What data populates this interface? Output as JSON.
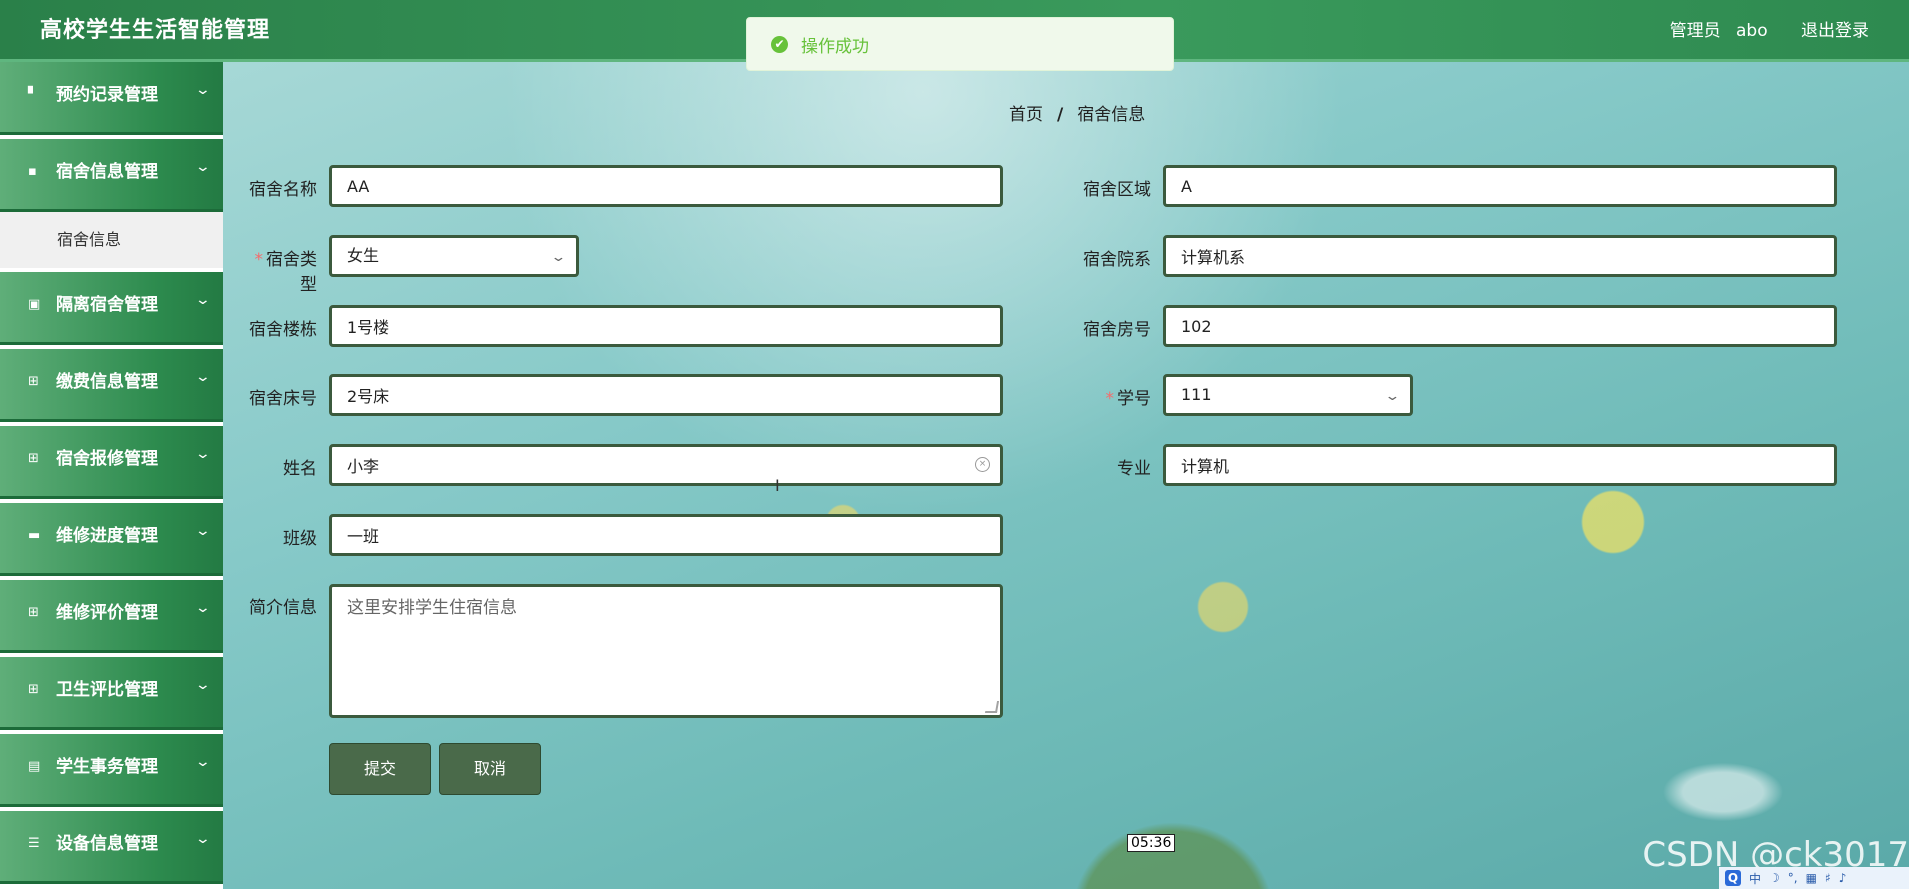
{
  "app": {
    "title": "高校学生生活智能管理"
  },
  "header": {
    "user_role": "管理员",
    "username": "abo",
    "logout_label": "退出登录"
  },
  "toast": {
    "message": "操作成功",
    "icon": "success-check-icon",
    "color": "#67c23a"
  },
  "sidebar": {
    "items": [
      {
        "label": "预约记录管理",
        "icon": "bookmark-icon",
        "glyph": "▘"
      },
      {
        "label": "宿舍信息管理",
        "icon": "chat-icon",
        "glyph": "▪",
        "expanded": true,
        "children": [
          {
            "label": "宿舍信息",
            "active": true
          }
        ]
      },
      {
        "label": "隔离宿舍管理",
        "icon": "checkbox-icon",
        "glyph": "▣"
      },
      {
        "label": "缴费信息管理",
        "icon": "grid-icon",
        "glyph": "⊞"
      },
      {
        "label": "宿舍报修管理",
        "icon": "grid-icon",
        "glyph": "⊞"
      },
      {
        "label": "维修进度管理",
        "icon": "briefcase-icon",
        "glyph": "▬"
      },
      {
        "label": "维修评价管理",
        "icon": "grid-icon",
        "glyph": "⊞"
      },
      {
        "label": "卫生评比管理",
        "icon": "grid-icon",
        "glyph": "⊞"
      },
      {
        "label": "学生事务管理",
        "icon": "clipboard-icon",
        "glyph": "▤"
      },
      {
        "label": "设备信息管理",
        "icon": "list-icon",
        "glyph": "☰"
      }
    ]
  },
  "breadcrumb": {
    "home": "首页",
    "separator": "/",
    "current": "宿舍信息"
  },
  "form": {
    "dorm_name": {
      "label": "宿舍名称",
      "value": "AA"
    },
    "dorm_area": {
      "label": "宿舍区域",
      "value": "A"
    },
    "dorm_type": {
      "label": "宿舍类型",
      "value": "女生",
      "required": true
    },
    "dorm_college": {
      "label": "宿舍院系",
      "value": "计算机系"
    },
    "dorm_building": {
      "label": "宿舍楼栋",
      "value": "1号楼"
    },
    "dorm_room": {
      "label": "宿舍房号",
      "value": "102"
    },
    "dorm_bed": {
      "label": "宿舍床号",
      "value": "2号床"
    },
    "student_id": {
      "label": "学号",
      "value": "111",
      "required": true
    },
    "name": {
      "label": "姓名",
      "value": "小李"
    },
    "major": {
      "label": "专业",
      "value": "计算机"
    },
    "class": {
      "label": "班级",
      "value": "一班"
    },
    "intro": {
      "label": "简介信息",
      "value": "这里安排学生住宿信息"
    },
    "required_mark": "*"
  },
  "buttons": {
    "submit": "提交",
    "cancel": "取消"
  },
  "overlay": {
    "timestamp": "05:36",
    "watermark": "CSDN @ck3017"
  },
  "tray": {
    "q": "Q",
    "items": [
      "中",
      "☽",
      "°,",
      "▦",
      "♯",
      "♪"
    ]
  },
  "colors": {
    "header": "#2e8a50",
    "accent": "#3b5a3d",
    "button": "#4a6a4a"
  }
}
